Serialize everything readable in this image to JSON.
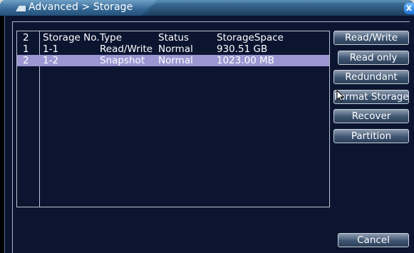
{
  "window": {
    "title": "Advanced > Storage",
    "close_label": "x"
  },
  "table": {
    "columns": [
      "2",
      "Storage No.",
      "Type",
      "Status",
      "StorageSpace"
    ],
    "rows": [
      {
        "index": "1",
        "storage_no": "1-1",
        "type": "Read/Write",
        "status": "Normal",
        "space": "930.51 GB",
        "selected": false
      },
      {
        "index": "2",
        "storage_no": "1-2",
        "type": "Snapshot",
        "status": "Normal",
        "space": "1023.00 MB",
        "selected": true
      }
    ]
  },
  "buttons": {
    "read_write": "Read/Write",
    "read_only": "Read only",
    "redundant": "Redundant",
    "format_storage": "Format Storage",
    "recover": "Recover",
    "partition": "Partition",
    "cancel": "Cancel"
  },
  "colors": {
    "selected_row": "#9c96d2",
    "panel_background": "#0b1530",
    "titlebar": "#2c5d86"
  }
}
